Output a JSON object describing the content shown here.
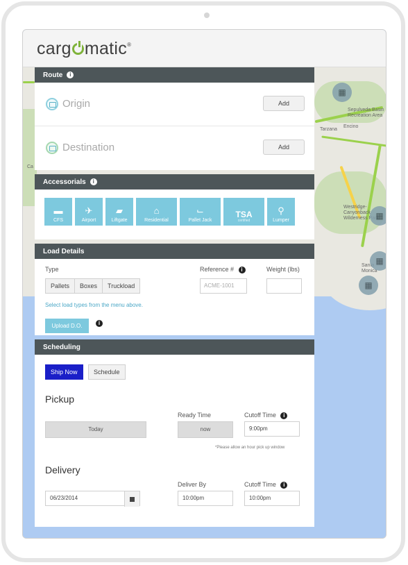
{
  "app": {
    "logo_before": "carg",
    "logo_after": "matic",
    "logo_mark": "®"
  },
  "route": {
    "title": "Route",
    "origin": {
      "label": "Origin",
      "button": "Add"
    },
    "destination": {
      "label": "Destination",
      "button": "Add"
    }
  },
  "accessorials": {
    "title": "Accessorials",
    "items": [
      {
        "label": "CFS",
        "icon": "cfs-icon"
      },
      {
        "label": "Airport",
        "icon": "airplane-icon"
      },
      {
        "label": "Liftgate",
        "icon": "truck-icon"
      },
      {
        "label": "Residential",
        "icon": "house-icon"
      },
      {
        "label": "Pallet Jack",
        "icon": "pallet-jack-icon"
      },
      {
        "label": "TSA",
        "sub": "certified",
        "icon": "tsa-icon"
      },
      {
        "label": "Lumper",
        "icon": "dolly-icon"
      }
    ]
  },
  "load_details": {
    "title": "Load Details",
    "type_label": "Type",
    "types": [
      "Pallets",
      "Boxes",
      "Truckload"
    ],
    "reference_label": "Reference #",
    "reference_placeholder": "ACME-1001",
    "weight_label": "Weight (lbs)",
    "weight_value": "",
    "hint": "Select load types from the menu above.",
    "upload_button": "Upload D.O."
  },
  "scheduling": {
    "title": "Scheduling",
    "ship_now": "Ship Now",
    "schedule": "Schedule",
    "pickup": {
      "title": "Pickup",
      "date_button": "Today",
      "ready_label": "Ready Time",
      "ready_value": "now",
      "cutoff_label": "Cutoff Time",
      "cutoff_value": "9:00pm",
      "note": "*Please allow an hour pick up window"
    },
    "delivery": {
      "title": "Delivery",
      "date_value": "06/23/2014",
      "deliver_by_label": "Deliver By",
      "deliver_by_value": "10:00pm",
      "cutoff_label": "Cutoff Time",
      "cutoff_value": "10:00pm"
    }
  },
  "map": {
    "labels": [
      "Tarzana",
      "Encino",
      "Sepulveda Basin Recreation Area",
      "Westridge-Canyonback Wilderness Park",
      "Santa Monica",
      "Ca"
    ]
  },
  "colors": {
    "section_bar": "#4d5659",
    "accent": "#7dc9de",
    "ship_now": "#1a1fc8",
    "logo_green": "#7fb33a"
  }
}
